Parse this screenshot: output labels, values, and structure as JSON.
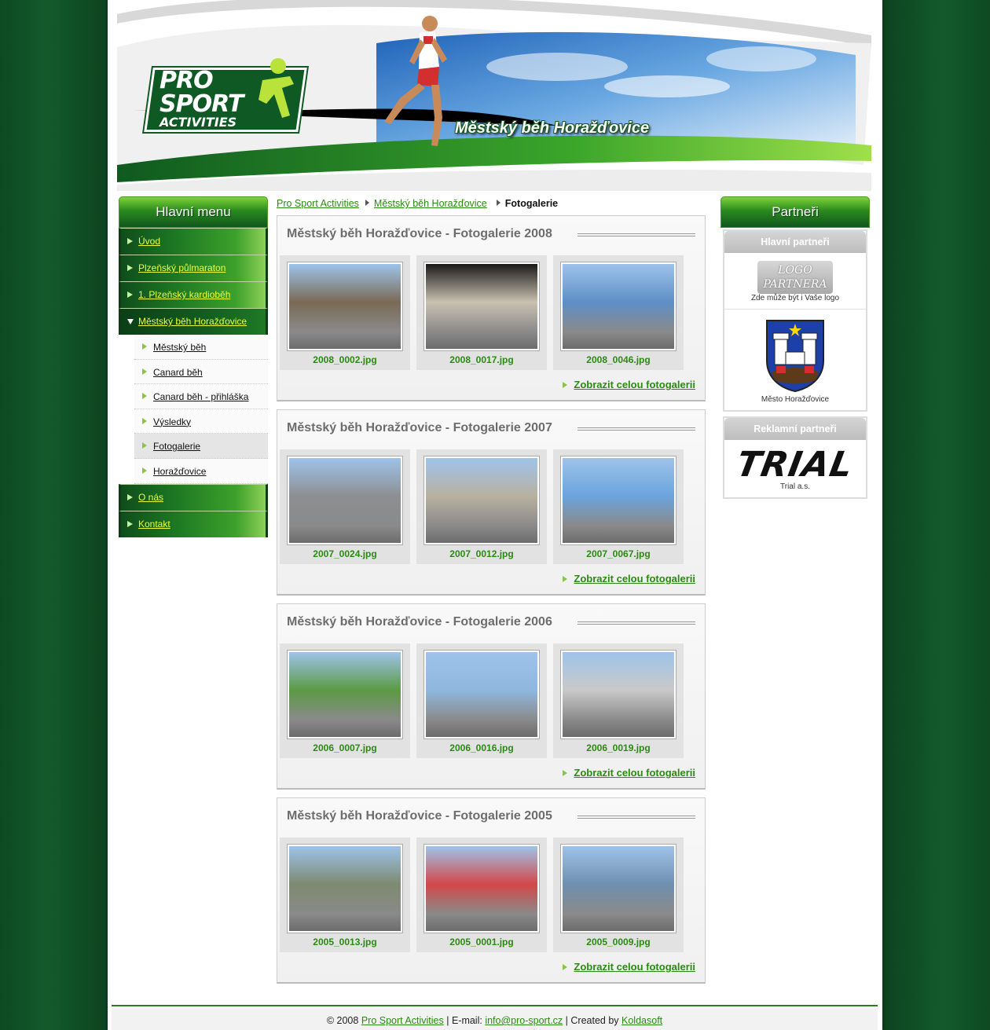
{
  "header": {
    "logo": {
      "line1": "PRO",
      "line2": "SPORT",
      "line3": "ACTIVITIES"
    },
    "title": "Městský běh Horažďovice"
  },
  "menu": {
    "title": "Hlavní menu",
    "items": [
      {
        "label": "Úvod"
      },
      {
        "label": "Plzeňský půlmaraton"
      },
      {
        "label": "1. Plzeňský kardioběh"
      },
      {
        "label": "Městský běh Horažďovice"
      }
    ],
    "subitems": [
      {
        "label": "Městský běh"
      },
      {
        "label": "Canard běh"
      },
      {
        "label": "Canard běh - přihláška"
      },
      {
        "label": "Výsledky"
      },
      {
        "label": "Fotogalerie"
      },
      {
        "label": "Horažďovice"
      }
    ],
    "items_after": [
      {
        "label": "O nás"
      },
      {
        "label": "Kontakt"
      }
    ]
  },
  "breadcrumb": {
    "home": "Pro Sport Activities",
    "section": "Městský běh Horažďovice",
    "current": "Fotogalerie"
  },
  "galleries": [
    {
      "title": "Městský běh Horažďovice - Fotogalerie 2008",
      "more": "Zobrazit celou fotogalerii",
      "photos": [
        "2008_0002.jpg",
        "2008_0017.jpg",
        "2008_0046.jpg"
      ]
    },
    {
      "title": "Městský běh Horažďovice - Fotogalerie 2007",
      "more": "Zobrazit celou fotogalerii",
      "photos": [
        "2007_0024.jpg",
        "2007_0012.jpg",
        "2007_0067.jpg"
      ]
    },
    {
      "title": "Městský běh Horažďovice - Fotogalerie 2006",
      "more": "Zobrazit celou fotogalerii",
      "photos": [
        "2006_0007.jpg",
        "2006_0016.jpg",
        "2006_0019.jpg"
      ]
    },
    {
      "title": "Městský běh Horažďovice - Fotogalerie 2005",
      "more": "Zobrazit celou fotogalerii",
      "photos": [
        "2005_0013.jpg",
        "2005_0001.jpg",
        "2005_0009.jpg"
      ]
    }
  ],
  "partners": {
    "title": "Partneři",
    "main_title": "Hlavní partneři",
    "logo_placeholder": {
      "line1": "LOGO",
      "line2": "PARTNERA"
    },
    "placeholder_caption": "Zde může být i Vaše logo",
    "city_caption": "Město Horažďovice",
    "ad_title": "Reklamní partneři",
    "trial_logo": "TRIAL",
    "trial_caption": "Trial a.s."
  },
  "footer": {
    "copy": "© 2008",
    "site": "Pro Sport Activities",
    "email_label": "| E-mail:",
    "email": "info@pro-sport.cz",
    "created_label": "| Created by",
    "creator": "Koldasoft"
  }
}
